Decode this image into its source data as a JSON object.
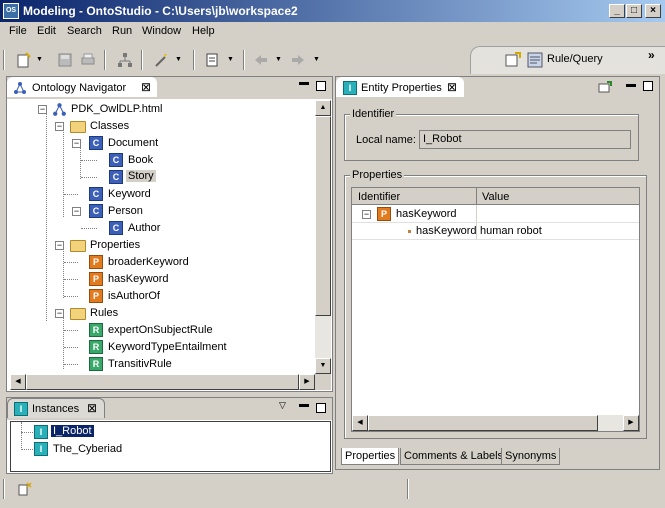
{
  "window": {
    "title": "Modeling - OntoStudio - C:\\Users\\jb\\workspace2",
    "app_icon_text": "OS",
    "buttons": [
      "_",
      "□",
      "×"
    ]
  },
  "menubar": {
    "items": [
      "File",
      "Edit",
      "Search",
      "Run",
      "Window",
      "Help"
    ]
  },
  "toolbar": {
    "perspective_label": "Rule/Query",
    "overflow": "»"
  },
  "navigator": {
    "tab_label": "Ontology Navigator",
    "tree": [
      {
        "label": "PDK_OwlDLP.html",
        "icon": "ontology-icon"
      },
      {
        "label": "Classes",
        "icon": "folder-icon"
      },
      {
        "label": "Document",
        "icon": "C"
      },
      {
        "label": "Book",
        "icon": "C"
      },
      {
        "label": "Story",
        "icon": "C"
      },
      {
        "label": "Keyword",
        "icon": "C"
      },
      {
        "label": "Person",
        "icon": "C"
      },
      {
        "label": "Author",
        "icon": "C"
      },
      {
        "label": "Properties",
        "icon": "folder-icon"
      },
      {
        "label": "broaderKeyword",
        "icon": "P"
      },
      {
        "label": "hasKeyword",
        "icon": "P"
      },
      {
        "label": "isAuthorOf",
        "icon": "P"
      },
      {
        "label": "Rules",
        "icon": "folder-icon"
      },
      {
        "label": "expertOnSubjectRule",
        "icon": "R"
      },
      {
        "label": "KeywordTypeEntailment",
        "icon": "R"
      },
      {
        "label": "TransitivRule",
        "icon": "R"
      }
    ]
  },
  "instances": {
    "tab_label": "Instances",
    "items": [
      {
        "label": "I_Robot",
        "icon": "I"
      },
      {
        "label": "The_Cyberiad",
        "icon": "I"
      }
    ]
  },
  "entity_properties": {
    "tab_label": "Entity Properties",
    "identifier_group": "Identifier",
    "local_name_label": "Local name:",
    "local_name_value": "I_Robot",
    "properties_group": "Properties",
    "columns": [
      "Identifier",
      "Value"
    ],
    "rows": [
      {
        "identifier": "hasKeyword",
        "value": "",
        "icon": "P"
      },
      {
        "identifier": "hasKeyword",
        "value": "human robot",
        "icon": ""
      }
    ],
    "bottom_tabs": [
      "Properties",
      "Comments & Labels",
      "Synonyms"
    ]
  },
  "colors": {
    "title_bar_start": "#0a246a",
    "title_bar_end": "#a6caf0",
    "selection": "#0a246a",
    "class_icon": "#3c5fb8",
    "property_icon": "#e07b20",
    "rule_icon": "#3aa86a",
    "instance_icon": "#2ab0b8"
  }
}
